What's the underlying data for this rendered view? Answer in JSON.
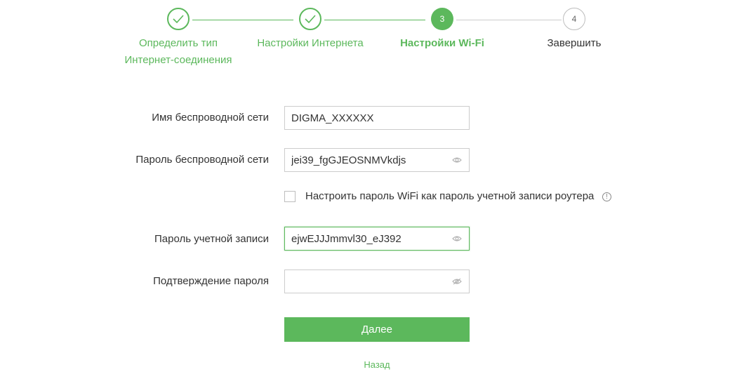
{
  "stepper": {
    "steps": [
      {
        "number": "1",
        "label_line1": "Определить тип",
        "label_line2": "Интернет-соединения",
        "state": "done"
      },
      {
        "number": "2",
        "label_line1": "Настройки Интернета",
        "state": "done"
      },
      {
        "number": "3",
        "label_line1": "Настройки Wi-Fi",
        "state": "active"
      },
      {
        "number": "4",
        "label_line1": "Завершить",
        "state": "todo"
      }
    ]
  },
  "form": {
    "ssid_label": "Имя беспроводной сети",
    "ssid_value": "DIGMA_XXXXXX",
    "wifi_password_label": "Пароль беспроводной сети",
    "wifi_password_value": "jei39_fgGJEOSNMVkdjs",
    "same_password_checkbox_label": "Настроить пароль WiFi как пароль учетной записи роутера",
    "same_password_checked": false,
    "account_password_label": "Пароль учетной записи",
    "account_password_value": "ejwEJJJmmvl30_eJ392",
    "confirm_password_label": "Подтверждение пароля",
    "confirm_password_value": "",
    "next_button": "Далее",
    "back_link": "Назад"
  },
  "colors": {
    "accent": "#5cb85c",
    "border": "#cccccc",
    "text": "#333333"
  }
}
